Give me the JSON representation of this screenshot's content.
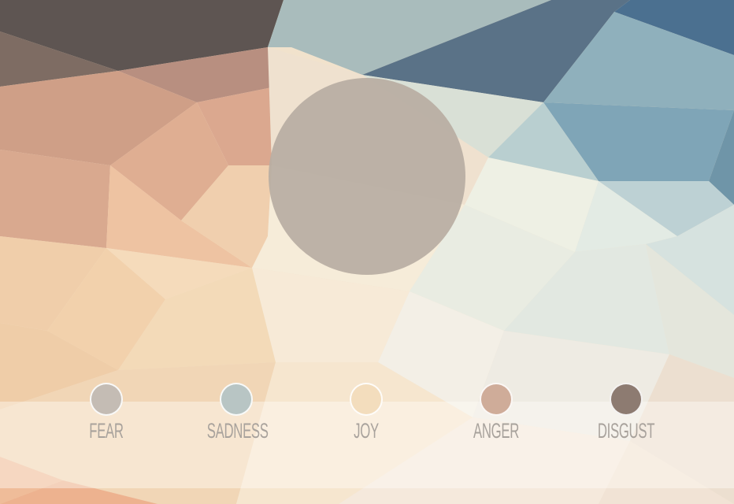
{
  "mood_circle": {
    "color": "#b8ada3"
  },
  "emotions": [
    {
      "label": "FEAR",
      "color": "#c4bcb4"
    },
    {
      "label": "SADNESS",
      "color": "#b8c5c4"
    },
    {
      "label": "JOY",
      "color": "#f3ddbd"
    },
    {
      "label": "ANGER",
      "color": "#cfac99"
    },
    {
      "label": "DISGUST",
      "color": "#8d7b71"
    }
  ]
}
